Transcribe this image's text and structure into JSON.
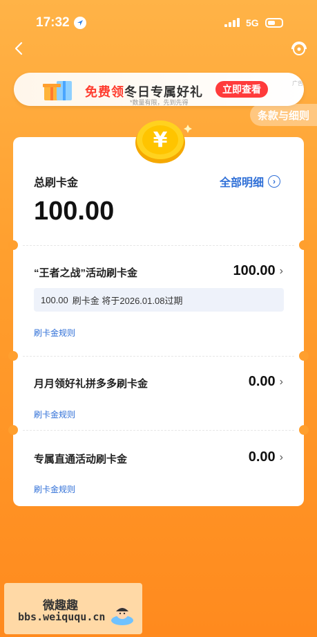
{
  "status": {
    "time": "17:32",
    "network": "5G"
  },
  "banner": {
    "title_red": "免费领",
    "title_dark": "冬日专属好礼",
    "subtitle": "*数量有限，先到先得",
    "button": "立即查看",
    "ad": "广告"
  },
  "terms_link": "条款与细则",
  "summary": {
    "label": "总刷卡金",
    "detail_link": "全部明细",
    "amount": "100.00"
  },
  "items": [
    {
      "title": "“王者之战”活动刷卡金",
      "amount": "100.00",
      "note_amount": "100.00",
      "note_text": "刷卡金 将于2026.01.08过期",
      "rule": "刷卡金规则"
    },
    {
      "title": "月月领好礼拼多多刷卡金",
      "amount": "0.00",
      "rule": "刷卡金规则"
    },
    {
      "title": "专属直通活动刷卡金",
      "amount": "0.00",
      "rule": "刷卡金规则"
    }
  ],
  "watermark": {
    "name": "微趣趣",
    "url": "bbs.weiququ.cn"
  },
  "colors": {
    "accent_blue": "#2f6fd7",
    "banner_red": "#ff3b3b",
    "background": "#ff9f2e"
  }
}
